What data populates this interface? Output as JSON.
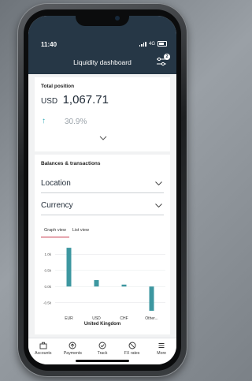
{
  "status_bar": {
    "time": "11:40",
    "network": "4G"
  },
  "header": {
    "title": "Liquidity dashboard",
    "filter_badge": "2"
  },
  "total_position": {
    "label": "Total position",
    "currency": "USD",
    "amount": "1,067.71",
    "change_percent": "30.9%"
  },
  "balances": {
    "title": "Balances & transactions",
    "location_label": "Location",
    "currency_label": "Currency",
    "tabs": [
      "Graph view",
      "List view"
    ],
    "active_tab": "Graph view"
  },
  "chart_data": {
    "type": "bar",
    "title": "United Kingdom",
    "categories": [
      "EUR",
      "USD",
      "CHF",
      "Other..."
    ],
    "values": [
      1200,
      200,
      60,
      -750
    ],
    "yticks": [
      "1.0k",
      "0.5k",
      "0.0k",
      "-0.5k"
    ],
    "ylim": [
      -800,
      1300
    ],
    "grid": true,
    "color": "#3d97a0"
  },
  "navbar": {
    "items": [
      {
        "label": "Accounts",
        "icon": "briefcase-icon"
      },
      {
        "label": "Payments",
        "icon": "payments-icon"
      },
      {
        "label": "Track",
        "icon": "track-icon"
      },
      {
        "label": "FX rates",
        "icon": "fx-rates-icon"
      },
      {
        "label": "More",
        "icon": "menu-icon"
      }
    ]
  },
  "colors": {
    "header_bg": "#263746",
    "accent_teal": "#2aa7b4",
    "tab_underline": "#c8354a"
  }
}
